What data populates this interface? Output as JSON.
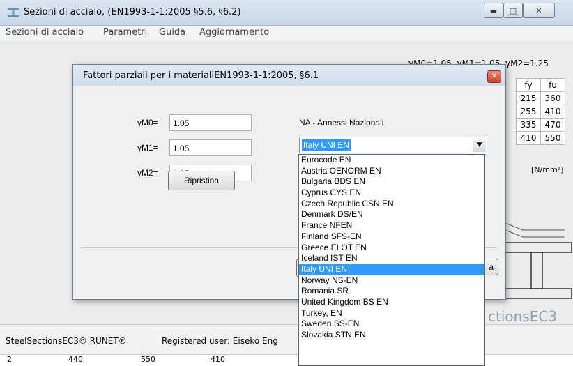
{
  "window": {
    "title": "Sezioni di acciaio, (EN1993-1-1:2005 §5.6, §6.2)"
  },
  "menu": [
    "Sezioni di acciaio",
    "Parametri",
    "Guida",
    "Aggiornamento"
  ],
  "background": {
    "gammas": "γM0=1.05, γM1=1.05, γM2=1.25",
    "table_headers": [
      "fy",
      "fu"
    ],
    "table_rows": [
      [
        "215",
        "360"
      ],
      [
        "255",
        "410"
      ],
      [
        "335",
        "470"
      ],
      [
        "410",
        "550"
      ]
    ],
    "unit": "[N/mm²]",
    "brand": "ctionsEC3"
  },
  "dialog": {
    "title": "Fattori parziali per i materialiEN1993-1-1:2005, §6.1",
    "params": [
      {
        "label": "γM0=",
        "value": "1.05"
      },
      {
        "label": "γM1=",
        "value": "1.05"
      },
      {
        "label": "γM2=",
        "value": "1.25"
      }
    ],
    "reset_label": "Ripristina",
    "na_label": "NA - Annessi Nazionali",
    "selected": "Italy UNI EN",
    "button_partial_right": "a"
  },
  "dropdown": {
    "options": [
      "Eurocode EN",
      "Austria OENORM EN",
      "Bulgaria BDS EN",
      "Cyprus CYS EN",
      "Czech Republic CSN EN",
      "Denmark DS/EN",
      "France NFEN",
      "Finland SFS-EN",
      "Greece ELOT EN",
      "Iceland IST EN",
      "Italy UNI EN",
      "Norway NS-EN",
      "Romania SR",
      "United Kingdom  BS EN",
      "Turkey, EN",
      "Sweden SS-EN",
      "Slovakia STN EN"
    ],
    "selected_index": 10
  },
  "status": {
    "copyright": "SteelSectionsEC3© RUNET®",
    "user": "Registered user: Eiseko Eng"
  },
  "bottom_row": [
    "2",
    "440",
    "550",
    "410"
  ]
}
